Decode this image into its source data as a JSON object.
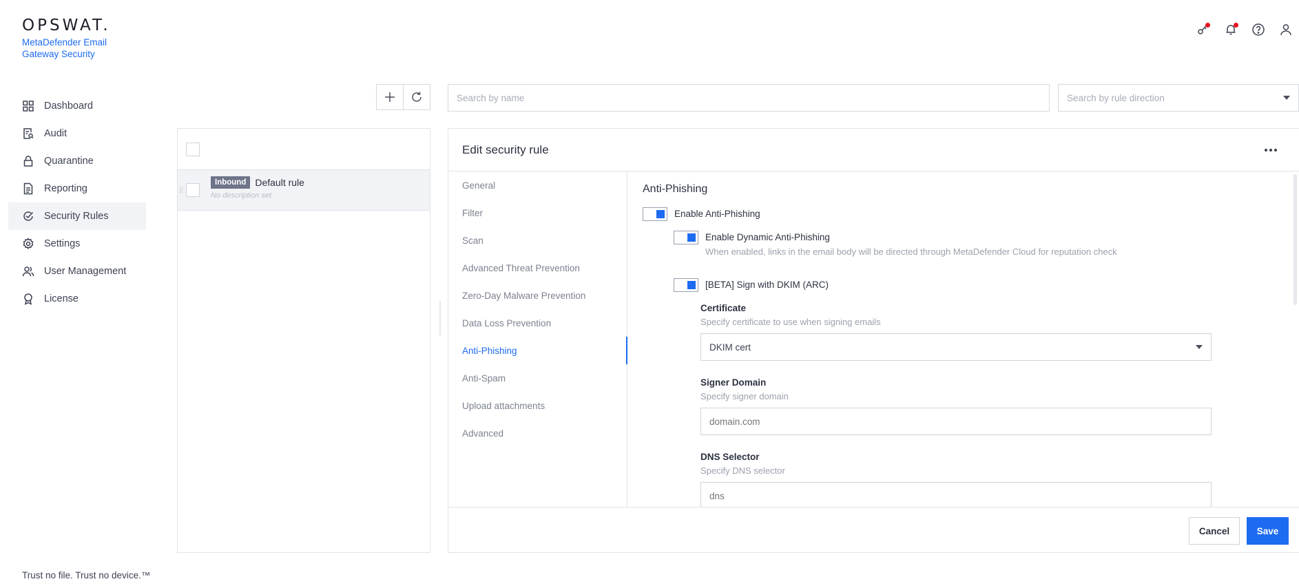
{
  "brand": {
    "logo": "OPSWAT.",
    "product": "MetaDefender Email Gateway Security",
    "accent_color": "#1d6bf0"
  },
  "header": {
    "icons": [
      "key-icon",
      "bell-icon",
      "help-icon",
      "user-icon"
    ],
    "notification_dot_color": "#e5131d"
  },
  "sidebar": {
    "items": [
      {
        "label": "Dashboard",
        "icon": "dashboard-icon",
        "active": false
      },
      {
        "label": "Audit",
        "icon": "audit-icon",
        "active": false
      },
      {
        "label": "Quarantine",
        "icon": "lock-icon",
        "active": false
      },
      {
        "label": "Reporting",
        "icon": "document-icon",
        "active": false
      },
      {
        "label": "Security Rules",
        "icon": "shield-check-icon",
        "active": true
      },
      {
        "label": "Settings",
        "icon": "gear-icon",
        "active": false
      },
      {
        "label": "User Management",
        "icon": "users-icon",
        "active": false
      },
      {
        "label": "License",
        "icon": "badge-icon",
        "active": false
      }
    ]
  },
  "footer": {
    "tagline": "Trust no file. Trust no device.™"
  },
  "toolbar": {
    "search_name_placeholder": "Search by name",
    "search_direction_placeholder": "Search by rule direction"
  },
  "rules": [
    {
      "direction": "Inbound",
      "name": "Default rule",
      "description": "No description set"
    }
  ],
  "edit": {
    "title": "Edit security rule",
    "tabs": [
      "General",
      "Filter",
      "Scan",
      "Advanced Threat Prevention",
      "Zero-Day Malware Prevention",
      "Data Loss Prevention",
      "Anti-Phishing",
      "Anti-Spam",
      "Upload attachments",
      "Advanced"
    ],
    "active_tab": "Anti-Phishing",
    "section_title": "Anti-Phishing",
    "enable_anti_phishing": {
      "label": "Enable Anti-Phishing",
      "on": true
    },
    "enable_dynamic": {
      "label": "Enable Dynamic Anti-Phishing",
      "description": "When enabled, links in the email body will be directed through MetaDefender Cloud for reputation check",
      "on": true
    },
    "sign_dkim": {
      "label": "[BETA] Sign with DKIM (ARC)",
      "on": true
    },
    "certificate": {
      "label": "Certificate",
      "description": "Specify certificate to use when signing emails",
      "value": "DKIM cert"
    },
    "signer_domain": {
      "label": "Signer Domain",
      "description": "Specify signer domain",
      "placeholder": "domain.com"
    },
    "dns_selector": {
      "label": "DNS Selector",
      "description": "Specify DNS selector",
      "placeholder": "dns"
    },
    "cancel_label": "Cancel",
    "save_label": "Save"
  }
}
